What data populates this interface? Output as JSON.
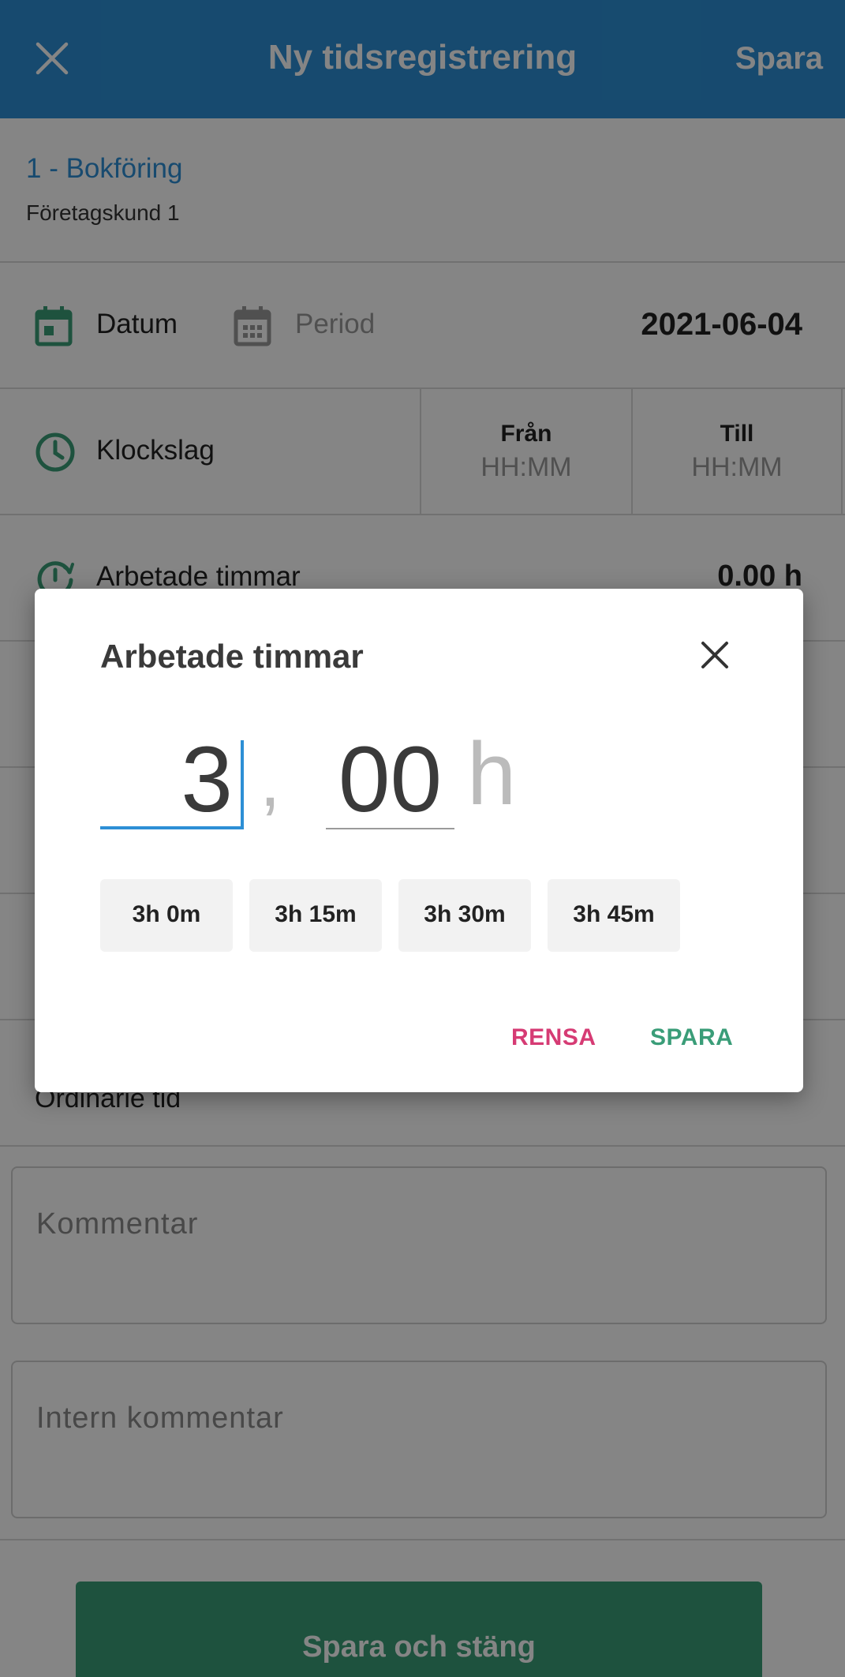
{
  "header": {
    "title": "Ny tidsregistrering",
    "save_label": "Spara"
  },
  "project": {
    "name": "1 - Bokföring",
    "customer": "Företagskund 1"
  },
  "date": {
    "datum_label": "Datum",
    "period_label": "Period",
    "value": "2021-06-04"
  },
  "time": {
    "label": "Klockslag",
    "from_label": "Från",
    "from_placeholder": "HH:MM",
    "to_label": "Till",
    "to_placeholder": "HH:MM"
  },
  "hours": {
    "label": "Arbetade timmar",
    "value": "0.00 h"
  },
  "ordinary": {
    "label": "Ordinarie tid"
  },
  "comment": {
    "placeholder": "Kommentar"
  },
  "internal_comment": {
    "placeholder": "Intern kommentar"
  },
  "footer": {
    "save_close_label": "Spara och stäng"
  },
  "dialog": {
    "title": "Arbetade timmar",
    "hours_value": "3",
    "separator": ",",
    "minutes_value": "00",
    "unit": "h",
    "chips": [
      "3h 0m",
      "3h 15m",
      "3h 30m",
      "3h 45m"
    ],
    "clear_label": "RENSA",
    "save_label": "SPARA"
  },
  "colors": {
    "header_bg": "#2d8fd5",
    "accent_blue": "#2d8fd5",
    "accent_green": "#3a9d78",
    "accent_pink": "#d63b74"
  }
}
